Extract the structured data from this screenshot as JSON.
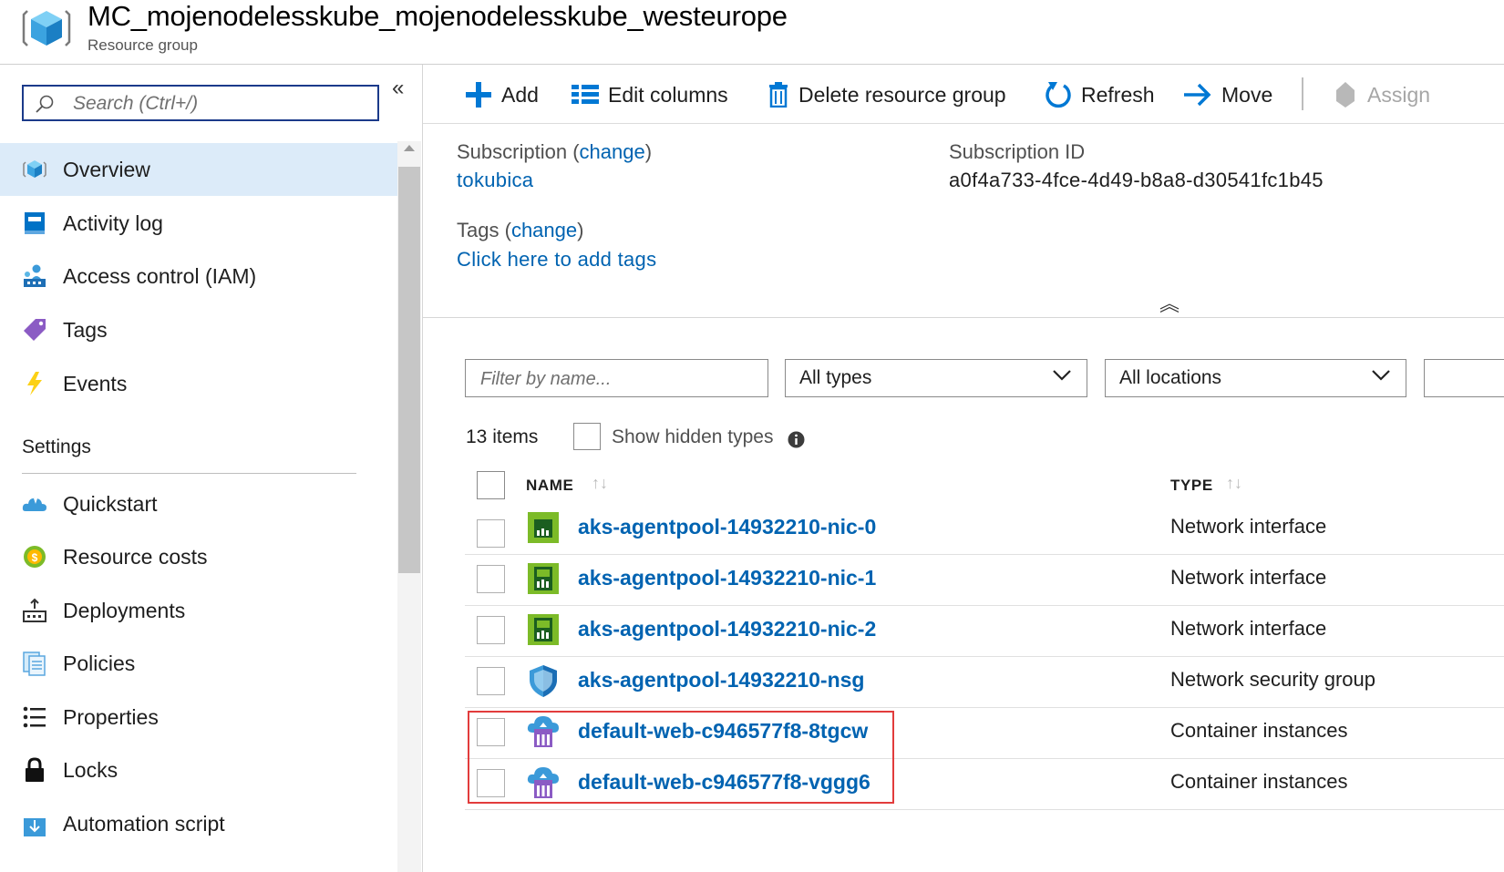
{
  "header": {
    "title": "MC_mojenodelesskube_mojenodelesskube_westeurope",
    "subtitle": "Resource group",
    "icon": "resource-group-icon"
  },
  "leftnav": {
    "search_placeholder": "Search (Ctrl+/)",
    "collapse_label": "«",
    "items": [
      {
        "label": "Overview",
        "icon": "overview-cube-icon",
        "selected": true
      },
      {
        "label": "Activity log",
        "icon": "activity-log-icon"
      },
      {
        "label": "Access control (IAM)",
        "icon": "iam-people-icon"
      },
      {
        "label": "Tags",
        "icon": "tag-icon"
      },
      {
        "label": "Events",
        "icon": "lightning-icon"
      }
    ],
    "settings_header": "Settings",
    "settings_items": [
      {
        "label": "Quickstart",
        "icon": "cloud-quickstart-icon"
      },
      {
        "label": "Resource costs",
        "icon": "cost-coin-icon"
      },
      {
        "label": "Deployments",
        "icon": "deployments-icon"
      },
      {
        "label": "Policies",
        "icon": "policies-document-icon"
      },
      {
        "label": "Properties",
        "icon": "properties-list-icon"
      },
      {
        "label": "Locks",
        "icon": "lock-icon"
      },
      {
        "label": "Automation script",
        "icon": "download-script-icon"
      }
    ]
  },
  "toolbar": {
    "add": "Add",
    "edit_columns": "Edit columns",
    "delete_group": "Delete resource group",
    "refresh": "Refresh",
    "move": "Move",
    "assign": "Assign"
  },
  "essentials": {
    "subscription_label": "Subscription",
    "change_link": "change",
    "subscription_value": "tokubica",
    "subscription_id_label": "Subscription ID",
    "subscription_id_value": "a0f4a733-4fce-4d49-b8a8-d30541fc1b45",
    "tags_label": "Tags",
    "tags_link": "Click here to add tags",
    "collapse_label": "︽"
  },
  "filters": {
    "name_placeholder": "Filter by name...",
    "types_value": "All types",
    "locations_value": "All locations"
  },
  "list": {
    "count": "13 items",
    "show_hidden": "Show hidden types",
    "col_name": "NAME",
    "col_type": "TYPE",
    "sort_glyph": "↑↓",
    "rows": [
      {
        "name": "aks-agentpool-14932210-nic-0",
        "type": "Network interface",
        "icon": "network-interface-icon"
      },
      {
        "name": "aks-agentpool-14932210-nic-1",
        "type": "Network interface",
        "icon": "network-interface-icon"
      },
      {
        "name": "aks-agentpool-14932210-nic-2",
        "type": "Network interface",
        "icon": "network-interface-icon"
      },
      {
        "name": "aks-agentpool-14932210-nsg",
        "type": "Network security group",
        "icon": "shield-icon"
      },
      {
        "name": "default-web-c946577f8-8tgcw",
        "type": "Container instances",
        "icon": "container-instance-icon"
      },
      {
        "name": "default-web-c946577f8-vggg6",
        "type": "Container instances",
        "icon": "container-instance-icon"
      }
    ]
  },
  "colors": {
    "link": "#0063b1",
    "selected_nav": "#dcebf9",
    "highlight": "#e23c3c",
    "accent": "#0078d4"
  }
}
